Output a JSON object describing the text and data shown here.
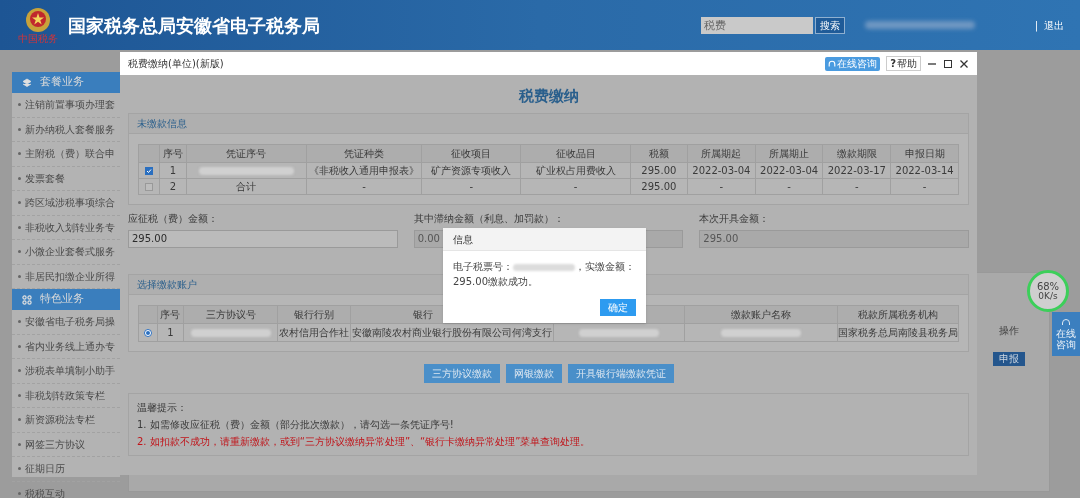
{
  "header": {
    "logo_caption": "中国税务",
    "title": "国家税务总局安徽省电子税务局",
    "search": {
      "placeholder": "税费"
    },
    "search_button": "搜索",
    "user_blurred": true,
    "separator": "|",
    "logout": "退出"
  },
  "sidebar": {
    "sections": [
      {
        "title": "套餐业务",
        "kind": "stack",
        "items": [
          "注销前置事项办理套",
          "新办纳税人套餐服务",
          "主附税（费）联合申",
          "发票套餐",
          "跨区域涉税事项综合",
          "非税收入划转业务专",
          "小微企业套餐式服务",
          "非居民扣缴企业所得"
        ]
      },
      {
        "title": "特色业务",
        "kind": "grid",
        "items": [
          "安徽省电子税务局操",
          "省内业务线上通办专",
          "涉税表单填制小助手",
          "非税划转政策专栏",
          "新资源税法专栏",
          "网签三方协议",
          "征期日历",
          "税税互动"
        ]
      }
    ]
  },
  "background_page": {
    "column_header": "操作",
    "action_button": "申报"
  },
  "window": {
    "title": "税费缴纳(单位)(新版)",
    "consult_button": "在线咨询",
    "help_icon": "?",
    "help_button": "帮助",
    "page_title": "税费缴纳",
    "unpaid": {
      "title": "未缴款信息",
      "columns": [
        "序号",
        "凭证序号",
        "凭证种类",
        "征收项目",
        "征收品目",
        "税额",
        "所属期起",
        "所属期止",
        "缴款期限",
        "申报日期"
      ],
      "rows": [
        {
          "checked": true,
          "cells": [
            "1",
            {
              "kind": "blurred"
            },
            "《非税收入通用申报表》",
            "矿产资源专项收入",
            "矿业权占用费收入",
            "295.00",
            "2022-03-04",
            "2022-03-04",
            "2022-03-17",
            "2022-03-14"
          ]
        },
        {
          "checked": false,
          "cells": [
            "2",
            "合计",
            "-",
            "-",
            "-",
            "295.00",
            "-",
            "-",
            "-",
            "-"
          ]
        }
      ]
    },
    "amounts": [
      {
        "label": "应征税（费）金额：",
        "value": "295.00",
        "disabled": false
      },
      {
        "label": "其中滞纳金额（利息、加罚款）：",
        "value": "0.00",
        "disabled": true
      },
      {
        "label": "本次开具金额：",
        "value": "295.00",
        "disabled": true
      }
    ],
    "accounts": {
      "title": "选择缴款账户",
      "columns": [
        {
          "kind": "text",
          "text": "序号"
        },
        {
          "kind": "text",
          "text": "三方协议号"
        },
        {
          "kind": "text",
          "text": "银行行别"
        },
        {
          "kind": "partial",
          "text": "银行"
        },
        {
          "kind": "covered"
        },
        {
          "kind": "text",
          "text": "缴款账户名称"
        },
        {
          "kind": "text",
          "text": "税款所属税务机构"
        }
      ],
      "rows": [
        {
          "selected": true,
          "cells": [
            "1",
            {
              "kind": "blurred"
            },
            "农村信用合作社",
            "安徽南陵农村商业银行股份有限公司何湾支行",
            {
              "kind": "blurred"
            },
            {
              "kind": "blurred"
            },
            "国家税务总局南陵县税务局"
          ]
        }
      ]
    },
    "buttons": [
      "三方协议缴款",
      "网银缴款",
      "开具银行端缴款凭证"
    ],
    "tips": [
      {
        "text": "温馨提示：",
        "kind": "plain"
      },
      {
        "text": "1. 如需修改应征税（费）金额（部分批次缴款），请勾选一条凭证序号!",
        "kind": "plain"
      },
      {
        "text": "2. 如扣款不成功，请重新缴款，或到“三方协议缴纳异常处理”、“银行卡缴纳异常处理”菜单查询处理。",
        "kind": "warning"
      }
    ]
  },
  "message_box": {
    "title": "信息",
    "before": "电子税票号：",
    "blurred": true,
    "after": "，实缴金额：295.00缴款成功。",
    "ok_button": "确定"
  },
  "speed_widget": {
    "percent": "68%",
    "speed": "0K/s"
  },
  "side_consult_button": "在线咨询"
}
